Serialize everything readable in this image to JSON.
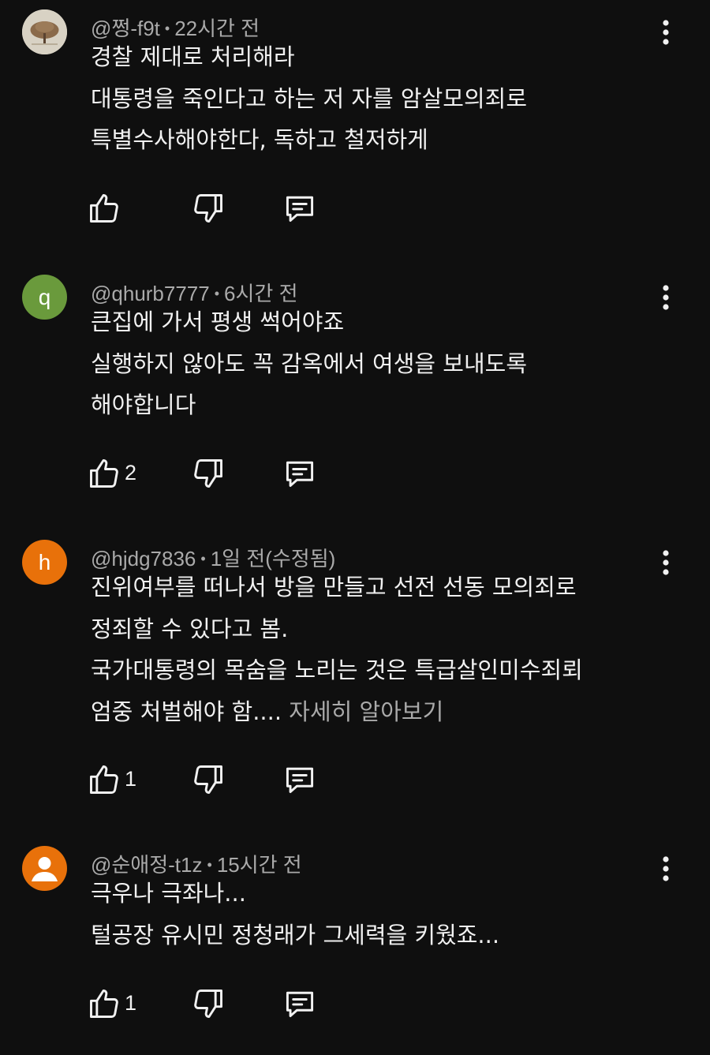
{
  "colors": {
    "background": "#0f0f0f",
    "text": "#f1f1f1",
    "secondary_text": "#aaaaaa",
    "avatar_q": "#6a9a3c",
    "avatar_h": "#e8710a",
    "avatar_person": "#e8710a"
  },
  "icons": {
    "like": "thumbs-up-icon",
    "dislike": "thumbs-down-icon",
    "reply": "reply-icon",
    "menu": "more-vert-icon"
  },
  "comments": [
    {
      "author": "@쩡-f9t",
      "time": "22시간 전",
      "avatar_type": "image",
      "lines": [
        "경찰 제대로 처리해라",
        "대통령을 죽인다고 하는 저 자를 암살모의죄로",
        "특별수사해야한다, 독하고 철저하게"
      ],
      "likes": ""
    },
    {
      "author": "@qhurb7777",
      "time": "6시간 전",
      "avatar_type": "letter",
      "avatar_letter": "q",
      "lines": [
        "큰집에 가서 평생 썩어야죠",
        "실행하지 않아도 꼭 감옥에서 여생을 보내도록",
        "해야합니다"
      ],
      "likes": "2"
    },
    {
      "author": "@hjdg7836",
      "time": "1일 전(수정됨)",
      "avatar_type": "letter",
      "avatar_letter": "h",
      "lines": [
        "진위여부를 떠나서 방을 만들고 선전 선동 모의죄로",
        "정죄할 수 있다고 봄.",
        "국가대통령의 목숨을 노리는 것은 특급살인미수죄뢰",
        "엄중 처벌해야 함...."
      ],
      "read_more": " 자세히 알아보기",
      "likes": "1"
    },
    {
      "author": "@순애정-t1z",
      "time": "15시간 전",
      "avatar_type": "person",
      "lines": [
        "극우나 극좌나...",
        "털공장 유시민 정청래가 그세력을 키웠죠..."
      ],
      "likes": "1"
    }
  ]
}
